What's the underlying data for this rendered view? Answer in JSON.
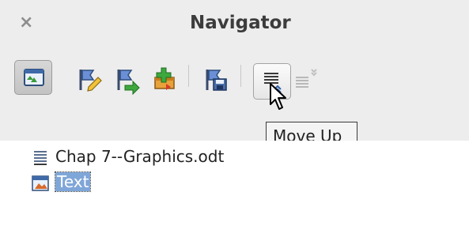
{
  "window": {
    "title": "Navigator",
    "close_glyph": "×"
  },
  "toolbar": {
    "buttons": [
      {
        "name": "toggle-icon",
        "state": "pressed"
      },
      {
        "name": "set-reminder-icon"
      },
      {
        "name": "navigation-icon"
      },
      {
        "name": "insert-icon"
      },
      {
        "name": "save-content-icon"
      },
      {
        "name": "move-up-icon",
        "state": "hover"
      },
      {
        "name": "move-down-icon",
        "state": "disabled"
      }
    ]
  },
  "tooltip": {
    "text": "Move Up"
  },
  "tree": {
    "items": [
      {
        "label": "Chap 7--Graphics.odt",
        "icon": "document-icon"
      },
      {
        "label": "Text",
        "icon": "text-content-icon",
        "selected": true
      }
    ]
  },
  "colors": {
    "panel_bg": "#ededed",
    "selection": "#7fa6d8"
  }
}
